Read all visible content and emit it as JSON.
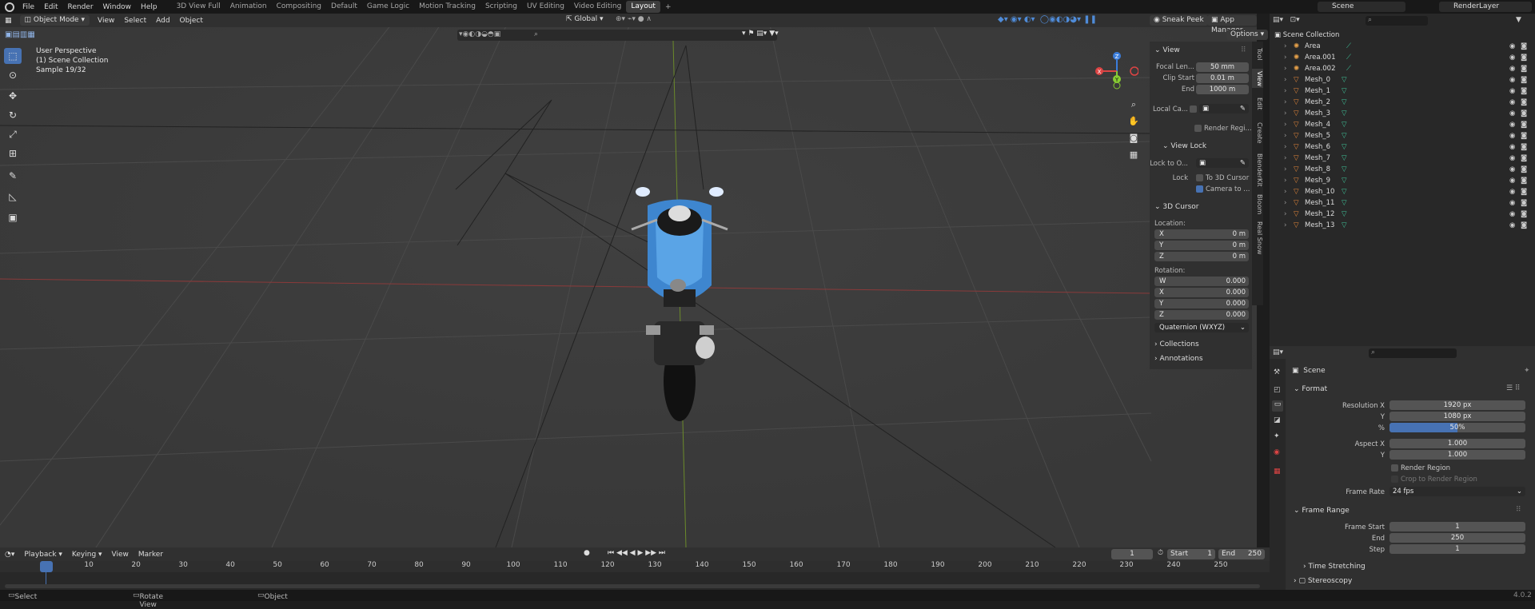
{
  "app_menu": [
    "File",
    "Edit",
    "Render",
    "Window",
    "Help"
  ],
  "workspaces": [
    "3D View Full",
    "Animation",
    "Compositing",
    "Default",
    "Game Logic",
    "Motion Tracking",
    "Scripting",
    "UV Editing",
    "Video Editing",
    "Layout"
  ],
  "active_workspace": "Layout",
  "scene_name": "Scene",
  "render_layer": "RenderLayer",
  "viewport_header": {
    "mode": "Object Mode",
    "menus": [
      "View",
      "Select",
      "Add",
      "Object"
    ],
    "orientation": "Global",
    "sneak_peek": "Sneak Peek",
    "app_manager": "App Manager",
    "options": "Options"
  },
  "overlay_text": {
    "line1": "User Perspective",
    "line2": "(1) Scene Collection",
    "line3": "Sample 19/32"
  },
  "gizmo": {
    "z": "Z",
    "y": "Y",
    "x": "X"
  },
  "npanel": {
    "view_header": "View",
    "focal_label": "Focal Len...",
    "focal_value": "50 mm",
    "clip_start_label": "Clip Start",
    "clip_start_value": "0.01 m",
    "end_label": "End",
    "end_value": "1000 m",
    "local_camera_label": "Local Ca...",
    "render_region_label": "Render Regi...",
    "view_lock_header": "View Lock",
    "lock_to_label": "Lock to O...",
    "lock_label": "Lock",
    "to_3d_cursor": "To 3D Cursor",
    "camera_to": "Camera to ...",
    "cursor_header": "3D Cursor",
    "location_label": "Location:",
    "loc_x_label": "X",
    "loc_x": "0 m",
    "loc_y_label": "Y",
    "loc_y": "0 m",
    "loc_z_label": "Z",
    "loc_z": "0 m",
    "rotation_label": "Rotation:",
    "rot_w_label": "W",
    "rot_w": "0.000",
    "rot_x_label": "X",
    "rot_x": "0.000",
    "rot_y_label": "Y",
    "rot_y": "0.000",
    "rot_z_label": "Z",
    "rot_z": "0.000",
    "rotation_mode": "Quaternion (WXYZ)",
    "collections": "Collections",
    "annotations": "Annotations"
  },
  "side_tabs": [
    "Tool",
    "View",
    "Edit",
    "Create",
    "BlenderKit",
    "Bloom",
    "Real Snow"
  ],
  "outliner": {
    "root": "Scene Collection",
    "items": [
      {
        "name": "Area",
        "type": "light"
      },
      {
        "name": "Area.001",
        "type": "light"
      },
      {
        "name": "Area.002",
        "type": "light"
      },
      {
        "name": "Mesh_0",
        "type": "mesh"
      },
      {
        "name": "Mesh_1",
        "type": "mesh"
      },
      {
        "name": "Mesh_2",
        "type": "mesh"
      },
      {
        "name": "Mesh_3",
        "type": "mesh"
      },
      {
        "name": "Mesh_4",
        "type": "mesh"
      },
      {
        "name": "Mesh_5",
        "type": "mesh"
      },
      {
        "name": "Mesh_6",
        "type": "mesh"
      },
      {
        "name": "Mesh_7",
        "type": "mesh"
      },
      {
        "name": "Mesh_8",
        "type": "mesh"
      },
      {
        "name": "Mesh_9",
        "type": "mesh"
      },
      {
        "name": "Mesh_10",
        "type": "mesh"
      },
      {
        "name": "Mesh_11",
        "type": "mesh"
      },
      {
        "name": "Mesh_12",
        "type": "mesh"
      },
      {
        "name": "Mesh_13",
        "type": "mesh"
      }
    ]
  },
  "properties": {
    "context": "Scene",
    "format_header": "Format",
    "res_x_label": "Resolution X",
    "res_x": "1920 px",
    "res_y_label": "Y",
    "res_y": "1080 px",
    "res_pct_label": "%",
    "res_pct": "50%",
    "res_pct_fraction": 0.5,
    "aspect_x_label": "Aspect X",
    "aspect_x": "1.000",
    "aspect_y_label": "Y",
    "aspect_y": "1.000",
    "render_region": "Render Region",
    "crop": "Crop to Render Region",
    "frame_rate_label": "Frame Rate",
    "frame_rate": "24 fps",
    "frame_range_header": "Frame Range",
    "frame_start_label": "Frame Start",
    "frame_start": "1",
    "frame_end_label": "End",
    "frame_end": "250",
    "step_label": "Step",
    "step": "1",
    "time_stretching": "Time Stretching",
    "stereoscopy": "Stereoscopy"
  },
  "timeline": {
    "menus": [
      "Playback",
      "Keying",
      "View",
      "Marker"
    ],
    "current_frame": "1",
    "start_label": "Start",
    "start": "1",
    "end_label": "End",
    "end": "250",
    "ticks": [
      "1",
      "10",
      "20",
      "30",
      "40",
      "50",
      "60",
      "70",
      "80",
      "90",
      "100",
      "110",
      "120",
      "130",
      "140",
      "150",
      "160",
      "170",
      "180",
      "190",
      "200",
      "210",
      "220",
      "230",
      "240",
      "250"
    ]
  },
  "status_bar": {
    "select": "Select",
    "rotate": "Rotate View",
    "object": "Object",
    "version": "4.0.2"
  },
  "colors": {
    "accent": "#4772b3",
    "light_icon": "#e8a24a",
    "mesh_icon": "#e8893a",
    "data_icon": "#3fc79c"
  }
}
